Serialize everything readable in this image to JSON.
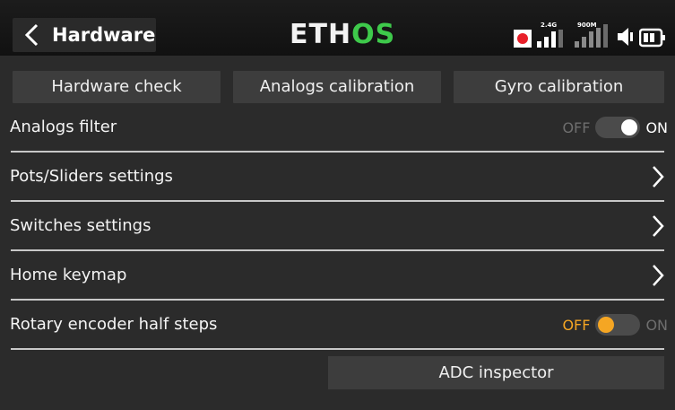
{
  "header": {
    "title": "Hardware",
    "logo_part1": "ETH",
    "logo_part2": "OS",
    "status": {
      "rf_band_1": "2.4G",
      "rf_band_2": "900M",
      "record_indicator_color": "#e8202a",
      "icons": [
        "record-icon",
        "signal-2g4-icon",
        "signal-900m-icon",
        "speaker-icon",
        "battery-icon"
      ]
    }
  },
  "buttons": {
    "hardware_check": "Hardware check",
    "analogs_calibration": "Analogs calibration",
    "gyro_calibration": "Gyro calibration"
  },
  "rows": {
    "analogs_filter": {
      "label": "Analogs filter",
      "off": "OFF",
      "on": "ON",
      "state": "on"
    },
    "pots_sliders": {
      "label": "Pots/Sliders settings"
    },
    "switches": {
      "label": "Switches settings"
    },
    "home_keymap": {
      "label": "Home keymap"
    },
    "rotary_encoder": {
      "label": "Rotary encoder half steps",
      "off": "OFF",
      "on": "ON",
      "state": "off"
    }
  },
  "adc_inspector": "ADC inspector",
  "colors": {
    "background": "#2b2b2b",
    "button": "#3d3d3d",
    "accent_green": "#3ec94b",
    "accent_orange": "#f5a623",
    "record_red": "#e8202a"
  }
}
